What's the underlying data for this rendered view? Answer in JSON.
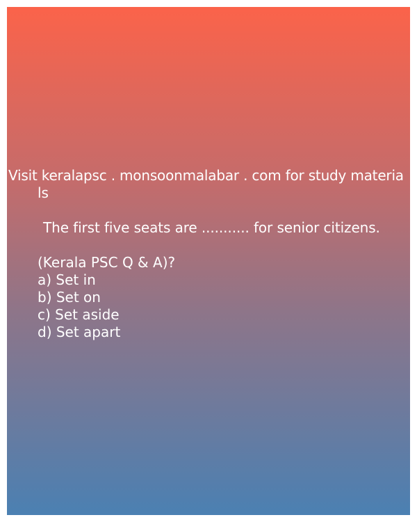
{
  "header": {
    "line1": "Visit keralapsc . monsoonmalabar . com for study materia",
    "line2": "ls"
  },
  "question": "The first five seats are ........... for senior citizens.",
  "source": "(Kerala PSC Q & A)?",
  "options": [
    "a) Set in",
    "b) Set on",
    "c) Set aside",
    "d) Set apart"
  ],
  "colors": {
    "gradient_top": "#fb634a",
    "gradient_bottom": "#4b80b2",
    "text": "#ffffff"
  }
}
